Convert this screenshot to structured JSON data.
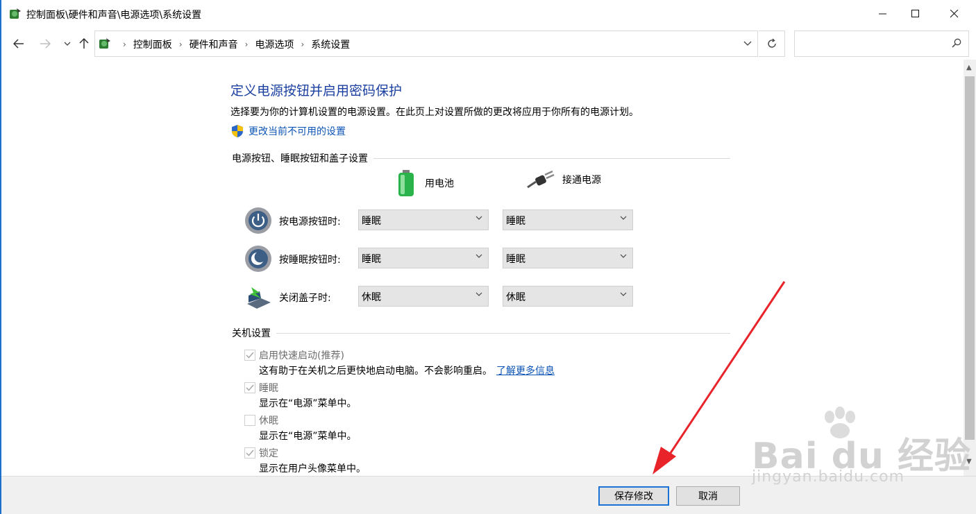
{
  "window": {
    "title": "控制面板\\硬件和声音\\电源选项\\系统设置",
    "minimize_label": "—",
    "maximize_label": "☐",
    "close_label": "✕"
  },
  "address": {
    "breadcrumbs": [
      "控制面板",
      "硬件和声音",
      "电源选项",
      "系统设置"
    ],
    "search_placeholder": ""
  },
  "page": {
    "heading": "定义电源按钮并启用密码保护",
    "description": "选择要为你的计算机设置的电源设置。在此页上对设置所做的更改将应用于你所有的电源计划。",
    "change_link": "更改当前不可用的设置"
  },
  "buttons_section": {
    "title": "电源按钮、睡眠按钮和盖子设置",
    "col_battery": "用电池",
    "col_plugged": "接通电源",
    "rows": [
      {
        "label": "按电源按钮时:",
        "battery": "睡眠",
        "plugged": "睡眠"
      },
      {
        "label": "按睡眠按钮时:",
        "battery": "睡眠",
        "plugged": "睡眠"
      },
      {
        "label": "关闭盖子时:",
        "battery": "休眠",
        "plugged": "休眠"
      }
    ]
  },
  "shutdown_section": {
    "title": "关机设置",
    "options": [
      {
        "label": "启用快速启动(推荐)",
        "desc": "这有助于在关机之后更快地启动电脑。不会影响重启。",
        "link": "了解更多信息",
        "checked": true
      },
      {
        "label": "睡眠",
        "desc": "显示在“电源”菜单中。",
        "checked": true
      },
      {
        "label": "休眠",
        "desc": "显示在“电源”菜单中。",
        "checked": false
      },
      {
        "label": "锁定",
        "desc": "显示在用户头像菜单中。",
        "checked": true
      }
    ]
  },
  "footer": {
    "save_label": "保存修改",
    "cancel_label": "取消"
  },
  "watermark": {
    "main": "Bai du 经验",
    "sub": "jingyan.baidu.com"
  },
  "colors": {
    "heading": "#1a3fa0",
    "link": "#0b53b5",
    "annotation_arrow": "#e8242a",
    "window_accent": "#1e6fc8"
  }
}
